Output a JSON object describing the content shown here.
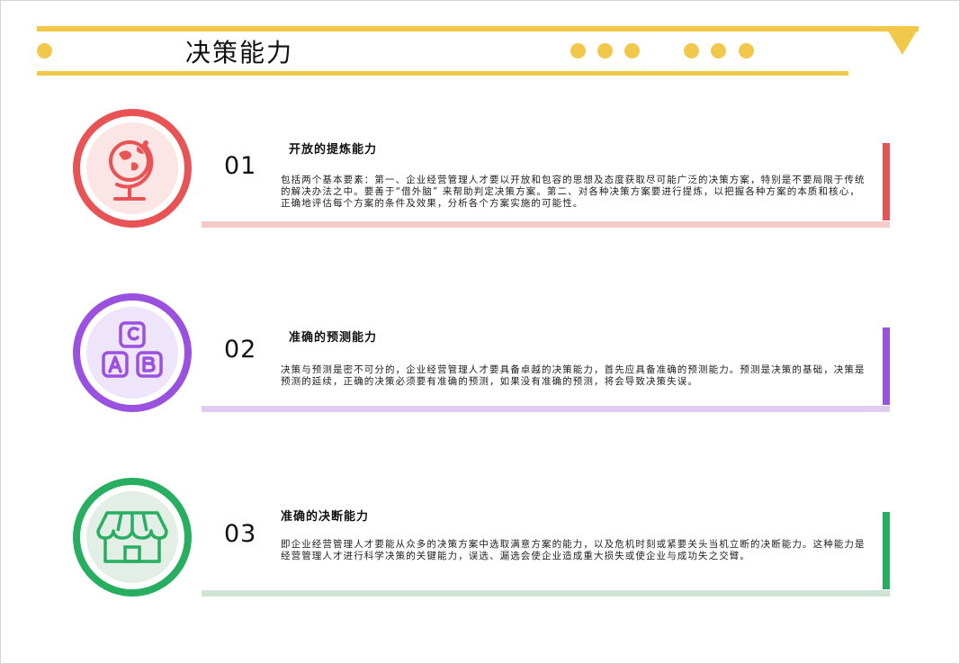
{
  "page": {
    "title": "决策能力",
    "accent_color": "#f2c84b"
  },
  "sections": [
    {
      "number": "01",
      "heading": "开放的提炼能力",
      "description": "包括两个基本要素：第一、企业经营管理人才要以开放和包容的思想及态度获取尽可能广泛的决策方案，特别是不要局限于传统的解决办法之中。要善于“借外脑” 来帮助判定决策方案。第二、对各种决策方案要进行提炼，以把握各种方案的本质和核心，正确地评估每个方案的条件及效果，分析各个方案实施的可能性。",
      "icon": "globe-icon",
      "color": "#e85456"
    },
    {
      "number": "02",
      "heading": "准确的预测能力",
      "description": "决策与预测是密不可分的，企业经营管理人才要具备卓越的决策能力，首先应具备准确的预测能力。预测是决策的基础，决策是预测的延续，正确的决策必须要有准确的预测，如果没有准确的预测，将会导致决策失误。",
      "icon": "abc-blocks-icon",
      "color": "#9b51e0"
    },
    {
      "number": "03",
      "heading": "准确的决断能力",
      "description": "即企业经营管理人才要能从众多的决策方案中选取满意方案的能力，以及危机时刻或紧要关头当机立断的决断能力。这种能力是经营管理人才进行科学决策的关键能力，误选、漏选会使企业造成重大损失或使企业与成功失之交臂。",
      "icon": "store-icon",
      "color": "#27ae60"
    }
  ]
}
